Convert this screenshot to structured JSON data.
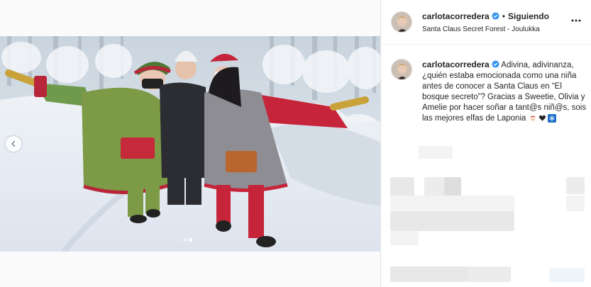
{
  "post": {
    "username": "carlotacorredera",
    "follow_status": "Siguiendo",
    "separator": "•",
    "location": "Santa Claus Secret Forest - Joulukka",
    "caption": {
      "username": "carlotacorredera",
      "text": "Adivina, adivinanza, ¿quién estaba emocionada como una niña antes de conocer a Santa Claus en “El bosque secreto”? Gracias a Sweetie, Olivia y Amelie por hacer soñar a tant@s niñ@s, sois las mejores elfas de Laponia",
      "emojis": [
        "santa-emoji",
        "heart-emoji",
        "snowflake-emoji"
      ]
    },
    "carousel": {
      "count": 2,
      "active_index": 1
    }
  },
  "colors": {
    "verified_blue": "#3897f0",
    "text": "#262626",
    "border": "#efefef"
  }
}
